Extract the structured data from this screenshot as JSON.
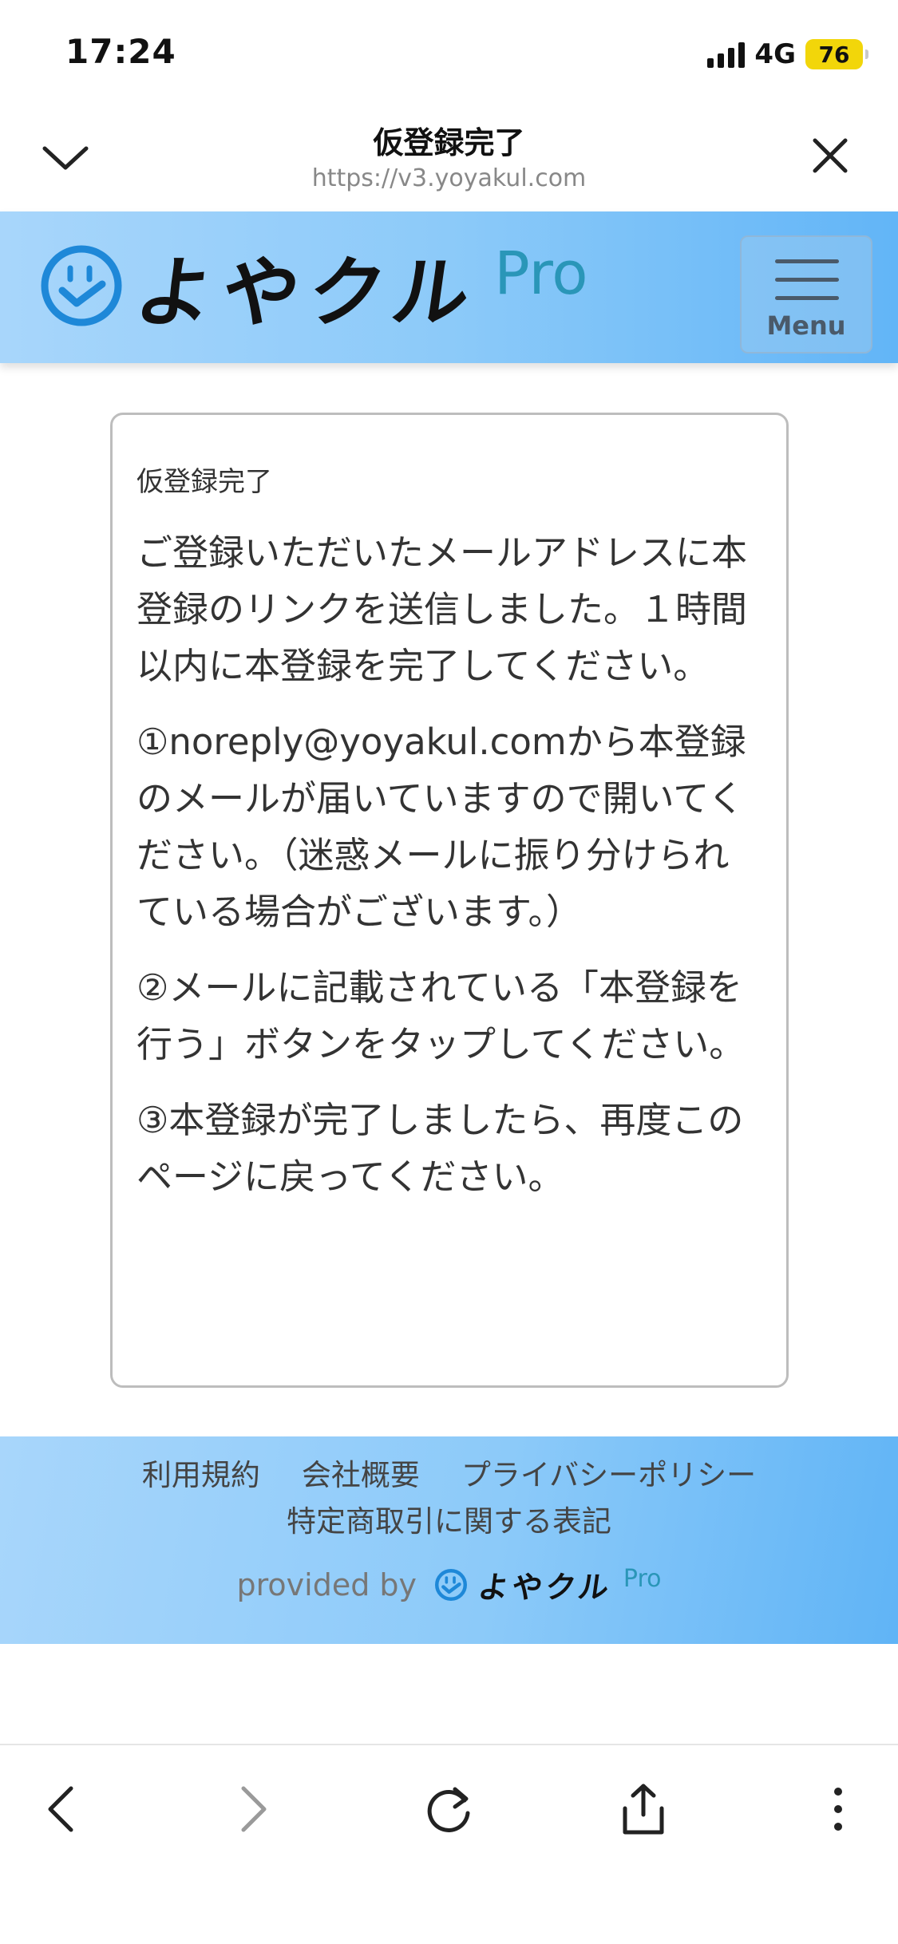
{
  "status_bar": {
    "time": "17:24",
    "network": "4G",
    "battery": "76"
  },
  "browser": {
    "title": "仮登録完了",
    "url": "https://v3.yoyakul.com"
  },
  "site_header": {
    "logo_text": "よやクル",
    "logo_suffix": "Pro",
    "menu_label": "Menu"
  },
  "card": {
    "heading": "仮登録完了",
    "paragraphs": [
      "ご登録いただいたメールアドレスに本登録のリンクを送信しました。１時間以内に本登録を完了してください。",
      "①noreply@yoyakul.comから本登録のメールが届いていますので開いてください。（迷惑メールに振り分けられている場合がございます。）",
      "②メールに記載されている「本登録を行う」ボタンをタップしてください。",
      "③本登録が完了しましたら、再度このページに戻ってください。"
    ]
  },
  "footer": {
    "links": [
      "利用規約",
      "会社概要",
      "プライバシーポリシー",
      "特定商取引に関する表記"
    ],
    "provided_by": "provided by",
    "logo_text": "よやクル",
    "logo_suffix": "Pro"
  },
  "toolbar": {
    "icons": [
      "back-icon",
      "forward-icon",
      "reload-icon",
      "share-icon",
      "more-icon"
    ]
  },
  "colors": {
    "header_gradient_start": "#a8d6fb",
    "header_gradient_end": "#62b5f7",
    "logo_blue": "#1e88d8",
    "pro_teal": "#2a96b8"
  }
}
